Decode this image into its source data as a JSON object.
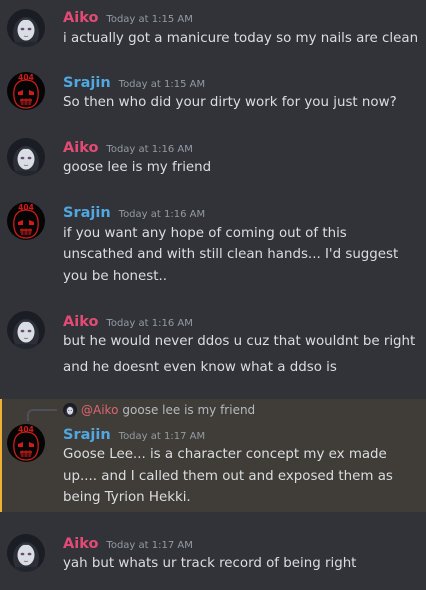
{
  "colors": {
    "background": "#313338",
    "reply_highlight": "#403d38",
    "aiko": "#e34b75",
    "srajin": "#51a7e0"
  },
  "users": {
    "aiko": {
      "name": "Aiko",
      "avatar_icon": "pale-face-avatar-icon"
    },
    "srajin": {
      "name": "Srajin",
      "avatar_icon": "red-404-mask-avatar-icon",
      "avatar_text": "404"
    }
  },
  "messages": [
    {
      "author": "Aiko",
      "timestamp": "Today at 1:15 AM",
      "lines": [
        "i actually got a manicure today so my nails are clean"
      ]
    },
    {
      "author": "Srajin",
      "timestamp": "Today at 1:15 AM",
      "lines": [
        "So then who did your dirty work for you just now?"
      ]
    },
    {
      "author": "Aiko",
      "timestamp": "Today at 1:16 AM",
      "lines": [
        "goose lee is my friend"
      ]
    },
    {
      "author": "Srajin",
      "timestamp": "Today at 1:16 AM",
      "lines": [
        "if you want any hope of coming out of this",
        "unscathed and with still clean hands... I'd suggest",
        "you be honest.."
      ]
    },
    {
      "author": "Aiko",
      "timestamp": "Today at 1:16 AM",
      "lines": [
        "but he would never ddos u cuz that wouldnt be right",
        "and he doesnt even know what a ddso is"
      ]
    },
    {
      "author": "Srajin",
      "timestamp": "Today at 1:17 AM",
      "reply": {
        "mention": "@Aiko",
        "text": "goose lee is my friend"
      },
      "lines": [
        "Goose Lee... is a character concept my ex made",
        "up.... and I called them out and exposed them as",
        "being Tyrion Hekki."
      ]
    },
    {
      "author": "Aiko",
      "timestamp": "Today at 1:17 AM",
      "lines": [
        "yah but whats ur track record of being right"
      ]
    }
  ]
}
